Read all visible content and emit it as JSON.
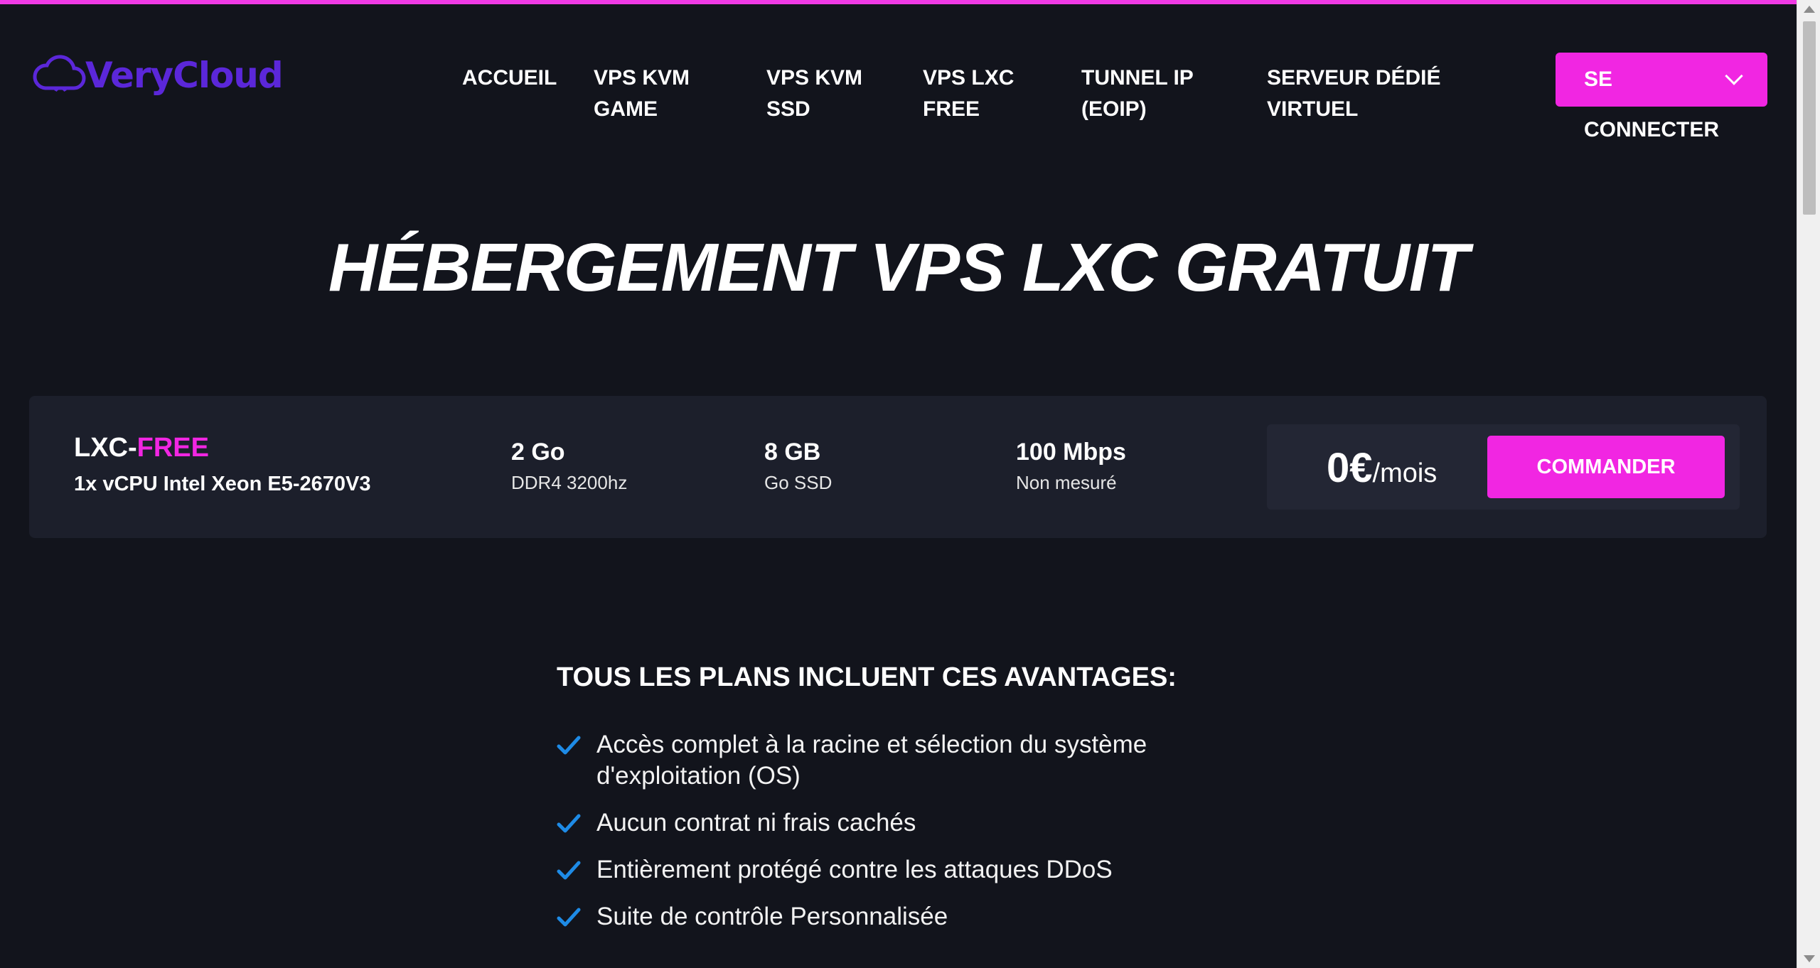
{
  "brand": {
    "name": "VeryCloud",
    "accent": "#f126e2",
    "logo_color": "#5b27d9",
    "background": "#12141c"
  },
  "nav": {
    "items": [
      {
        "lines": [
          "ACCUEIL"
        ]
      },
      {
        "lines": [
          "VPS KVM",
          "GAME"
        ]
      },
      {
        "lines": [
          "VPS KVM",
          "SSD"
        ]
      },
      {
        "lines": [
          "VPS LXC",
          "FREE"
        ]
      },
      {
        "lines": [
          "TUNNEL IP",
          "(EOIP)"
        ]
      },
      {
        "lines": [
          "SERVEUR DÉDIÉ",
          "VIRTUEL"
        ]
      }
    ],
    "login_line1": "SE",
    "login_line2": "CONNECTER",
    "login_icon": "chevron-down-icon"
  },
  "hero": {
    "title": "HÉBERGEMENT VPS LXC GRATUIT"
  },
  "plan": {
    "name_prefix": "LXC-",
    "name_accent": "FREE",
    "cpu": "1x vCPU Intel Xeon E5-2670V3",
    "specs": [
      {
        "value": "2 Go",
        "sub": "DDR4 3200hz"
      },
      {
        "value": "8 GB",
        "sub": "Go SSD"
      },
      {
        "value": "100 Mbps",
        "sub": "Non mesuré"
      }
    ],
    "price": "0€",
    "per": "/mois",
    "order_label": "COMMANDER"
  },
  "advantages": {
    "title": "TOUS LES PLANS INCLUENT CES AVANTAGES:",
    "icon": "check-icon",
    "items": [
      "Accès complet à la racine et sélection du système d'exploitation (OS)",
      "Aucun contrat ni frais cachés",
      "Entièrement protégé contre les attaques DDoS",
      "Suite de contrôle Personnalisée"
    ]
  }
}
